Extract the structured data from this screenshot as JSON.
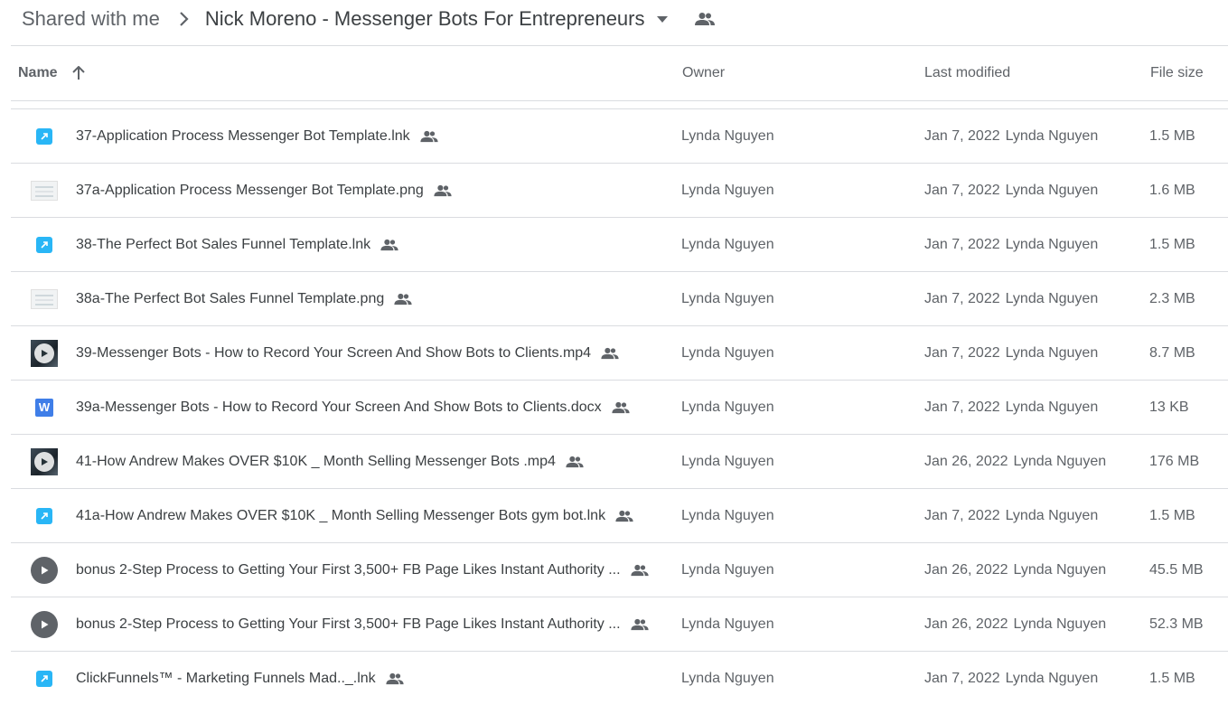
{
  "breadcrumb": {
    "root": "Shared with me",
    "current": "Nick Moreno - Messenger Bots For Entrepreneurs"
  },
  "columns": {
    "name": "Name",
    "owner": "Owner",
    "last_modified": "Last modified",
    "file_size": "File size"
  },
  "icons": {
    "sort": "arrow-up-icon",
    "separator": "chevron-right-icon",
    "caret": "caret-down-icon",
    "shared": "people-icon"
  },
  "colors": {
    "lnk": "#29b6f6",
    "docx": "#3f7ee8",
    "divider": "#dadce0",
    "text": "#3c4043",
    "muted": "#5f6368"
  },
  "files": [
    {
      "name": "37-Application Process Messenger Bot Template.lnk",
      "type": "lnk",
      "owner": "Lynda Nguyen",
      "date": "Jan 7, 2022",
      "modified_by": "Lynda Nguyen",
      "size": "1.5 MB"
    },
    {
      "name": "37a-Application Process Messenger Bot Template.png",
      "type": "png",
      "owner": "Lynda Nguyen",
      "date": "Jan 7, 2022",
      "modified_by": "Lynda Nguyen",
      "size": "1.6 MB"
    },
    {
      "name": "38-The Perfect Bot Sales Funnel Template.lnk",
      "type": "lnk",
      "owner": "Lynda Nguyen",
      "date": "Jan 7, 2022",
      "modified_by": "Lynda Nguyen",
      "size": "1.5 MB"
    },
    {
      "name": "38a-The Perfect Bot Sales Funnel Template.png",
      "type": "png",
      "owner": "Lynda Nguyen",
      "date": "Jan 7, 2022",
      "modified_by": "Lynda Nguyen",
      "size": "2.3 MB"
    },
    {
      "name": "39-Messenger Bots - How to Record Your Screen And Show Bots to Clients.mp4",
      "type": "video-thumb",
      "owner": "Lynda Nguyen",
      "date": "Jan 7, 2022",
      "modified_by": "Lynda Nguyen",
      "size": "8.7 MB"
    },
    {
      "name": "39a-Messenger Bots - How to Record Your Screen And Show Bots to Clients.docx",
      "type": "docx",
      "owner": "Lynda Nguyen",
      "date": "Jan 7, 2022",
      "modified_by": "Lynda Nguyen",
      "size": "13 KB"
    },
    {
      "name": "41-How Andrew Makes OVER $10K _ Month Selling Messenger Bots .mp4",
      "type": "video-thumb",
      "owner": "Lynda Nguyen",
      "date": "Jan 26, 2022",
      "modified_by": "Lynda Nguyen",
      "size": "176 MB"
    },
    {
      "name": "41a-How Andrew Makes OVER $10K _ Month Selling Messenger Bots gym bot.lnk",
      "type": "lnk",
      "owner": "Lynda Nguyen",
      "date": "Jan 7, 2022",
      "modified_by": "Lynda Nguyen",
      "size": "1.5 MB"
    },
    {
      "name": "bonus 2-Step Process to Getting Your First 3,500+ FB Page Likes  Instant Authority ...",
      "type": "video-play",
      "owner": "Lynda Nguyen",
      "date": "Jan 26, 2022",
      "modified_by": "Lynda Nguyen",
      "size": "45.5 MB"
    },
    {
      "name": "bonus 2-Step Process to Getting Your First 3,500+ FB Page Likes  Instant Authority ...",
      "type": "video-play",
      "owner": "Lynda Nguyen",
      "date": "Jan 26, 2022",
      "modified_by": "Lynda Nguyen",
      "size": "52.3 MB"
    },
    {
      "name": "ClickFunnels™ - Marketing Funnels Mad.._.lnk",
      "type": "lnk",
      "owner": "Lynda Nguyen",
      "date": "Jan 7, 2022",
      "modified_by": "Lynda Nguyen",
      "size": "1.5 MB"
    }
  ]
}
